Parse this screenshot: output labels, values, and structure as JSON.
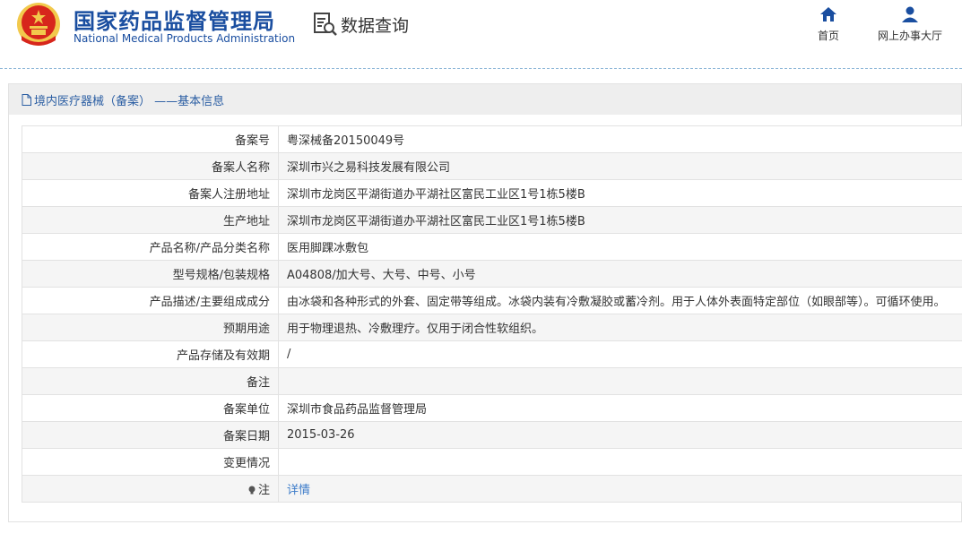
{
  "header": {
    "brand_cn": "国家药品监督管理局",
    "brand_en": "National Medical Products Administration",
    "search_title": "数据查询",
    "nav": [
      {
        "label": "首页",
        "icon": "home-icon"
      },
      {
        "label": "网上办事大厅",
        "icon": "user-icon"
      }
    ]
  },
  "panel": {
    "title": "境内医疗器械（备案） ——基本信息",
    "rows": [
      {
        "label": "备案号",
        "value": "粤深械备20150049号"
      },
      {
        "label": "备案人名称",
        "value": "深圳市兴之易科技发展有限公司"
      },
      {
        "label": "备案人注册地址",
        "value": "深圳市龙岗区平湖街道办平湖社区富民工业区1号1栋5楼B"
      },
      {
        "label": "生产地址",
        "value": "深圳市龙岗区平湖街道办平湖社区富民工业区1号1栋5楼B"
      },
      {
        "label": "产品名称/产品分类名称",
        "value": "医用脚踝冰敷包"
      },
      {
        "label": "型号规格/包装规格",
        "value": "A04808/加大号、大号、中号、小号"
      },
      {
        "label": "产品描述/主要组成成分",
        "value": "由冰袋和各种形式的外套、固定带等组成。冰袋内装有冷敷凝胶或蓄冷剂。用于人体外表面特定部位（如眼部等）。可循环使用。"
      },
      {
        "label": "预期用途",
        "value": "用于物理退热、冷敷理疗。仅用于闭合性软组织。"
      },
      {
        "label": "产品存储及有效期",
        "value": "/"
      },
      {
        "label": "备注",
        "value": ""
      },
      {
        "label": "备案单位",
        "value": "深圳市食品药品监督管理局"
      },
      {
        "label": "备案日期",
        "value": "2015-03-26"
      },
      {
        "label": "变更情况",
        "value": ""
      },
      {
        "label": "注",
        "value": "详情"
      }
    ]
  },
  "colors": {
    "brand_blue": "#1a4ea0",
    "link_blue": "#3d7cc9",
    "emblem_red": "#d7261c",
    "emblem_gold": "#f2c94c"
  }
}
